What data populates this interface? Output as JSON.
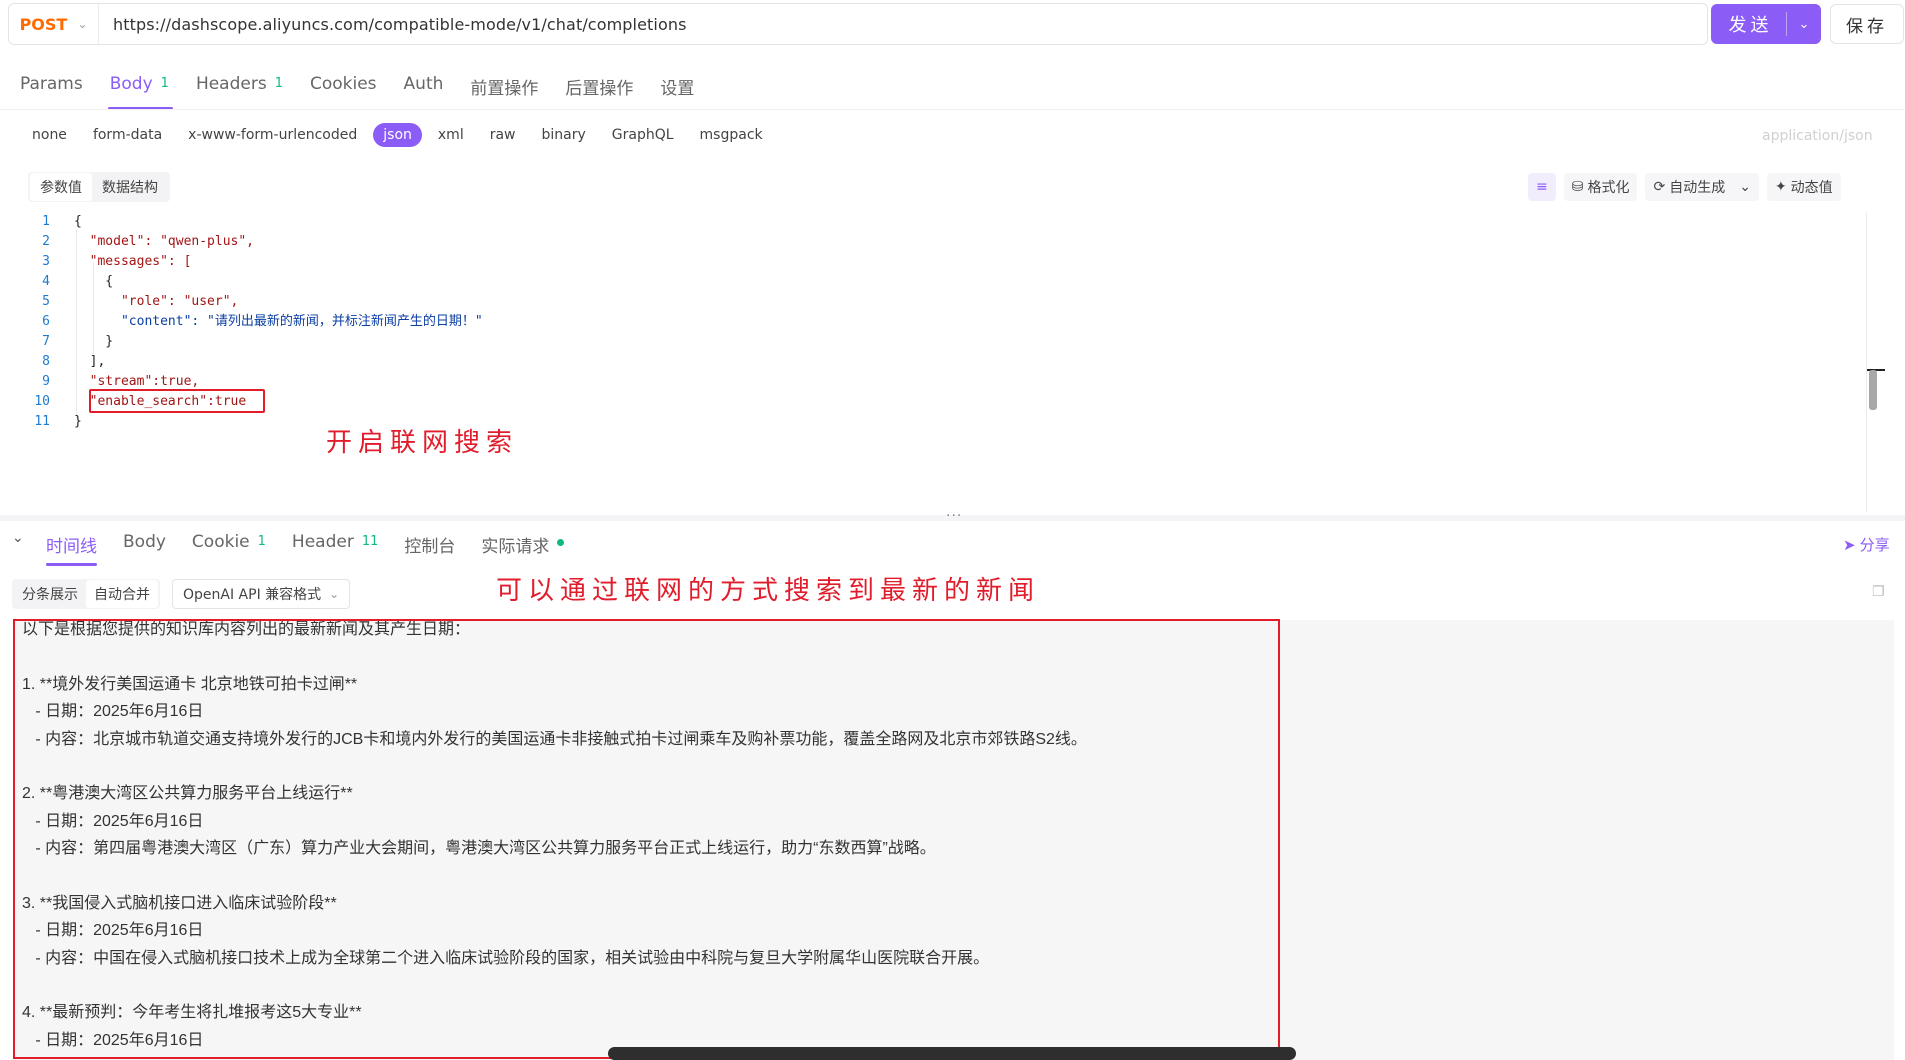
{
  "request": {
    "method": "POST",
    "url": "https://dashscope.aliyuncs.com/compatible-mode/v1/chat/completions",
    "send_label": "发送",
    "save_label": "保存"
  },
  "request_tabs": [
    {
      "label": "Params"
    },
    {
      "label": "Body",
      "count": "1"
    },
    {
      "label": "Headers",
      "count": "1"
    },
    {
      "label": "Cookies"
    },
    {
      "label": "Auth"
    },
    {
      "label": "前置操作"
    },
    {
      "label": "后置操作"
    },
    {
      "label": "设置"
    }
  ],
  "body_types": [
    "none",
    "form-data",
    "x-www-form-urlencoded",
    "json",
    "xml",
    "raw",
    "binary",
    "GraphQL",
    "msgpack"
  ],
  "content_type": "application/json",
  "editor_toolbar": {
    "seg_values": "参数值",
    "seg_schema": "数据结构",
    "format": "格式化",
    "auto_generate": "自动生成",
    "dynamic_value": "动态值"
  },
  "code_lines": [
    "{",
    "  \"model\": \"qwen-plus\",",
    "  \"messages\": [",
    "    {",
    "      \"role\": \"user\",",
    "      \"content\": \"请列出最新的新闻，并标注新闻产生的日期！\"",
    "    }",
    "  ],",
    "  \"stream\":true,",
    "  \"enable_search\":true",
    "}"
  ],
  "annotation_request": "开启联网搜索",
  "response_tabs": [
    {
      "label": "时间线"
    },
    {
      "label": "Body"
    },
    {
      "label": "Cookie",
      "count": "1"
    },
    {
      "label": "Header",
      "count": "11"
    },
    {
      "label": "控制台"
    },
    {
      "label": "实际请求"
    }
  ],
  "share_label": "分享",
  "response_controls": {
    "split_view": "分条展示",
    "auto_merge": "自动合并",
    "format_select": "OpenAI API 兼容格式"
  },
  "annotation_response": "可以通过联网的方式搜索到最新的新闻",
  "response_lines": [
    "以下是根据您提供的知识库内容列出的最新新闻及其产生日期：",
    "",
    "1. **境外发行美国运通卡 北京地铁可拍卡过闸**",
    "   - 日期：2025年6月16日",
    "   - 内容：北京城市轨道交通支持境外发行的JCB卡和境内外发行的美国运通卡非接触式拍卡过闸乘车及购补票功能，覆盖全路网及北京市郊铁路S2线。",
    "",
    "2. **粤港澳大湾区公共算力服务平台上线运行**",
    "   - 日期：2025年6月16日",
    "   - 内容：第四届粤港澳大湾区（广东）算力产业大会期间，粤港澳大湾区公共算力服务平台正式上线运行，助力“东数西算”战略。",
    "",
    "3. **我国侵入式脑机接口进入临床试验阶段**",
    "   - 日期：2025年6月16日",
    "   - 内容：中国在侵入式脑机接口技术上成为全球第二个进入临床试验阶段的国家，相关试验由中科院与复旦大学附属华山医院联合开展。",
    "",
    "4. **最新预判：今年考生将扎堆报考这5大专业**",
    "   - 日期：2025年6月16日"
  ],
  "colors": {
    "accent": "#8b5cf6",
    "method": "#ff6b00",
    "annotation": "#e11d2c",
    "count": "#10b981"
  }
}
